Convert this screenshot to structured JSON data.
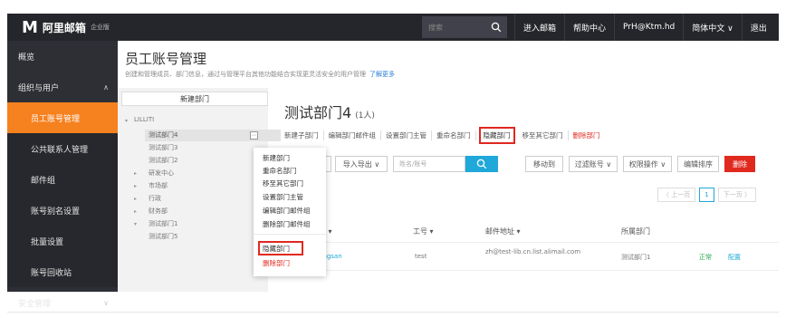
{
  "topbar": {
    "logo_mark": "M",
    "logo_text": "阿里邮箱",
    "logo_sub": "企业版",
    "search_placeholder": "搜索",
    "links": [
      "进入邮箱",
      "帮助中心",
      "PrH@Ktm.hd",
      "简体中文 ∨",
      "退出"
    ]
  },
  "sidebar": {
    "items": [
      {
        "label": "概览",
        "type": "top"
      },
      {
        "label": "组织与用户",
        "type": "group",
        "chev": "∧"
      },
      {
        "label": "员工账号管理",
        "type": "sub",
        "active": true
      },
      {
        "label": "公共联系人管理",
        "type": "sub"
      },
      {
        "label": "邮件组",
        "type": "sub"
      },
      {
        "label": "账号别名设置",
        "type": "sub"
      },
      {
        "label": "批量设置",
        "type": "sub"
      },
      {
        "label": "账号回收站",
        "type": "sub"
      },
      {
        "label": "安全管理",
        "type": "group",
        "chev": "∨"
      }
    ]
  },
  "header": {
    "title": "员工账号管理",
    "desc": "创建和管理成员、部门信息，通过与管理平台其他功能结合实现更灵活安全的用户管理",
    "more": "了解更多"
  },
  "tree": {
    "new_dept": "新建部门",
    "root": "LILLITI",
    "nodes": [
      {
        "label": "测试部门4",
        "selected": true
      },
      {
        "label": "测试部门3"
      },
      {
        "label": "测试部门2"
      },
      {
        "label": "研发中心"
      },
      {
        "label": "市场部"
      },
      {
        "label": "行政"
      },
      {
        "label": "财务部"
      },
      {
        "label": "测试部门1"
      },
      {
        "label": "测试部门5"
      }
    ],
    "more_icon": "⋯"
  },
  "dept": {
    "title": "测试部门4",
    "count": "(1人)",
    "actions": [
      "新建子部门",
      "编辑部门邮件组",
      "设置部门主管",
      "重命名部门",
      "隐藏部门",
      "移至其它部门",
      "删除部门"
    ]
  },
  "toolbar": {
    "new_btn": "新建",
    "import_export": "导入导出 ∨",
    "search_placeholder": "姓名/账号",
    "move": "移动到",
    "filter": "过滤账号 ∨",
    "perm": "权限操作 ∨",
    "sort": "编辑排序",
    "delete": "删除"
  },
  "pager": {
    "prev": "〈 上一页",
    "page": "1",
    "next": "下一页 〉"
  },
  "table": {
    "headers": [
      "姓名 ▾",
      "工号 ▾",
      "邮件地址 ▾",
      "所属部门",
      "",
      ""
    ],
    "row": [
      "zhangsan",
      "test",
      "zh@test-lib.cn.list.alimail.com",
      "测试部门1",
      "正常",
      "配置"
    ]
  },
  "context_menu": {
    "items": [
      "新建部门",
      "重命名部门",
      "移至其它部门",
      "设置部门主管",
      "编辑部门邮件组",
      "删除部门邮件组"
    ],
    "hide": "隐藏部门",
    "delete": "删除部门"
  },
  "colors": {
    "accent": "#f5811f",
    "highlight": "#e0291f",
    "primary": "#1fa8d9",
    "dark": "#25262b"
  }
}
